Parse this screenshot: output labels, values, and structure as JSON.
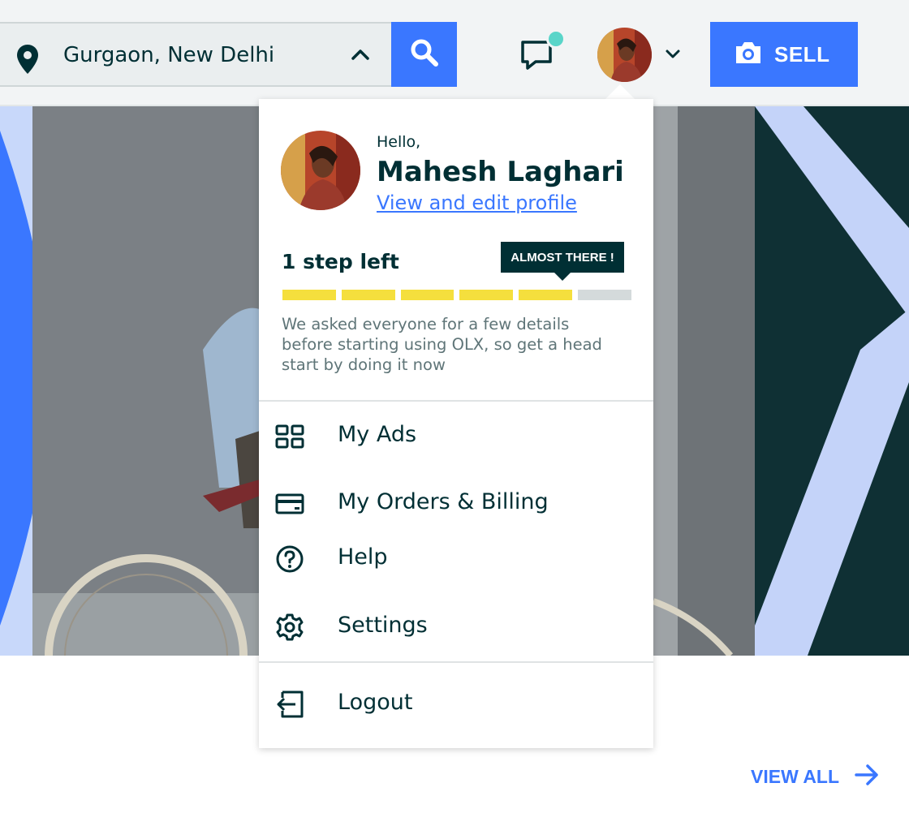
{
  "header": {
    "location": {
      "value": "Gurgaon, New Delhi",
      "pin_icon": "location-pin-icon",
      "toggle_icon": "chevron-up-icon"
    },
    "search_icon": "search-icon",
    "chat_icon": "chat-icon",
    "chevron_icon": "chevron-down-icon",
    "sell": {
      "label": "SELL",
      "icon": "camera-icon"
    }
  },
  "profile_menu": {
    "greeting": "Hello,",
    "user_name": "Mahesh Laghari",
    "profile_link": "View and edit profile",
    "progress": {
      "label": "1 step left",
      "tooltip": "ALMOST THERE !",
      "completed_steps": 5,
      "total_steps": 6
    },
    "description": "We asked everyone for a few details before starting using OLX, so get a head start by doing it now",
    "items": [
      {
        "label": "My Ads",
        "icon": "grid-icon"
      },
      {
        "label": "My Orders & Billing",
        "icon": "credit-card-icon"
      },
      {
        "label": "Help",
        "icon": "help-circle-icon"
      },
      {
        "label": "Settings",
        "icon": "gear-icon"
      }
    ],
    "logout": {
      "label": "Logout",
      "icon": "logout-icon"
    }
  },
  "view_all": {
    "label": "VIEW ALL",
    "icon": "arrow-right-icon"
  },
  "colors": {
    "brand_blue": "#3a77ff",
    "dark_teal": "#002f34",
    "progress_filled": "#f5df3d",
    "progress_empty": "#d4dadb",
    "notification_dot": "#5ad5c9"
  }
}
